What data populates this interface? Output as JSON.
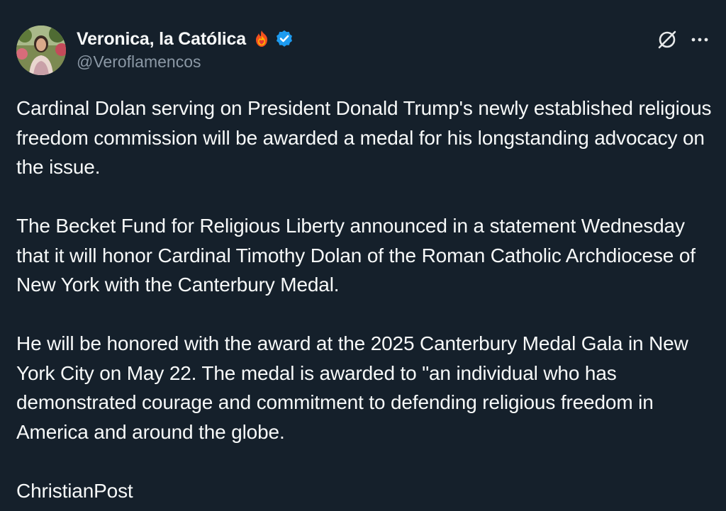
{
  "author": {
    "display_name": "Veronica, la Católica",
    "handle": "@Veroflamencos",
    "verified_color": "#1d9bf0",
    "badge_icon": "fire-heart-icon"
  },
  "actions": {
    "grok_icon": "grok-icon",
    "more_icon": "more-options-icon"
  },
  "post": {
    "paragraphs": [
      "Cardinal Dolan serving on President Donald Trump's newly established religious freedom commission will be awarded a medal for his longstanding advocacy on the issue.",
      "The Becket Fund for Religious Liberty announced in a statement Wednesday that it will honor Cardinal Timothy Dolan of the Roman Catholic Archdiocese of New York with the Canterbury Medal.",
      "He will be honored with the award at the 2025 Canterbury Medal Gala in New York City on May 22. The medal is awarded to \"an individual who has demonstrated courage and commitment to defending religious freedom in America and around the globe.",
      "ChristianPost"
    ]
  },
  "theme": {
    "background": "#15202b",
    "text": "#f7f9f9",
    "secondary_text": "#8b98a5"
  }
}
